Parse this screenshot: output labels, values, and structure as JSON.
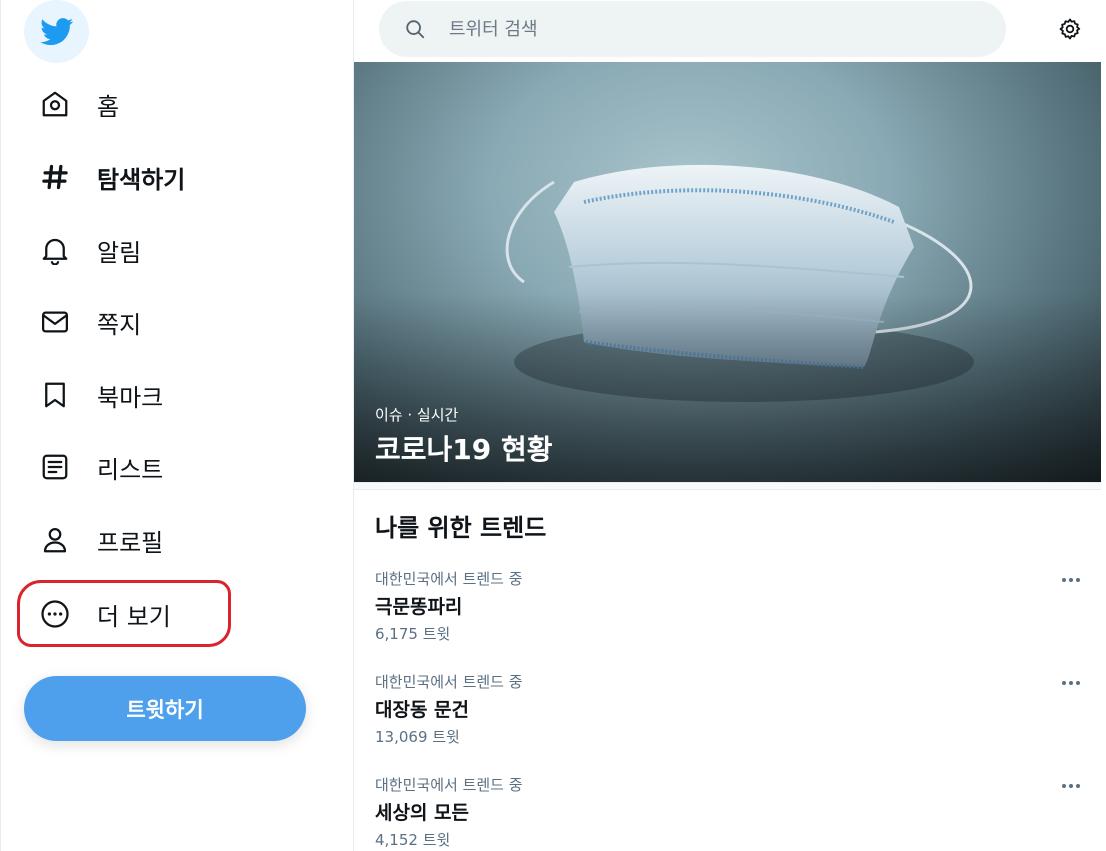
{
  "nav": {
    "items": [
      {
        "label": "홈",
        "icon": "home-icon"
      },
      {
        "label": "탐색하기",
        "icon": "hashtag-icon",
        "active": true
      },
      {
        "label": "알림",
        "icon": "bell-icon"
      },
      {
        "label": "쪽지",
        "icon": "mail-icon"
      },
      {
        "label": "북마크",
        "icon": "bookmark-icon"
      },
      {
        "label": "리스트",
        "icon": "list-icon"
      },
      {
        "label": "프로필",
        "icon": "profile-icon"
      },
      {
        "label": "더 보기",
        "icon": "more-circle-icon"
      }
    ],
    "tweet_button": "트윗하기"
  },
  "search": {
    "placeholder": "트위터 검색"
  },
  "hero": {
    "meta": "이슈 · 실시간",
    "title": "코로나19 현황"
  },
  "trends": {
    "title": "나를 위한 트렌드",
    "items": [
      {
        "context": "대한민국에서 트렌드 중",
        "name": "극문똥파리",
        "count": "6,175 트윗"
      },
      {
        "context": "대한민국에서 트렌드 중",
        "name": "대장동 문건",
        "count": "13,069 트윗"
      },
      {
        "context": "대한민국에서 트렌드 중",
        "name": "세상의 모든",
        "count": "4,152 트윗"
      }
    ]
  },
  "colors": {
    "accent": "#1d9bf0",
    "tweet_button": "#4fa0ec",
    "highlight": "#d9232d"
  }
}
